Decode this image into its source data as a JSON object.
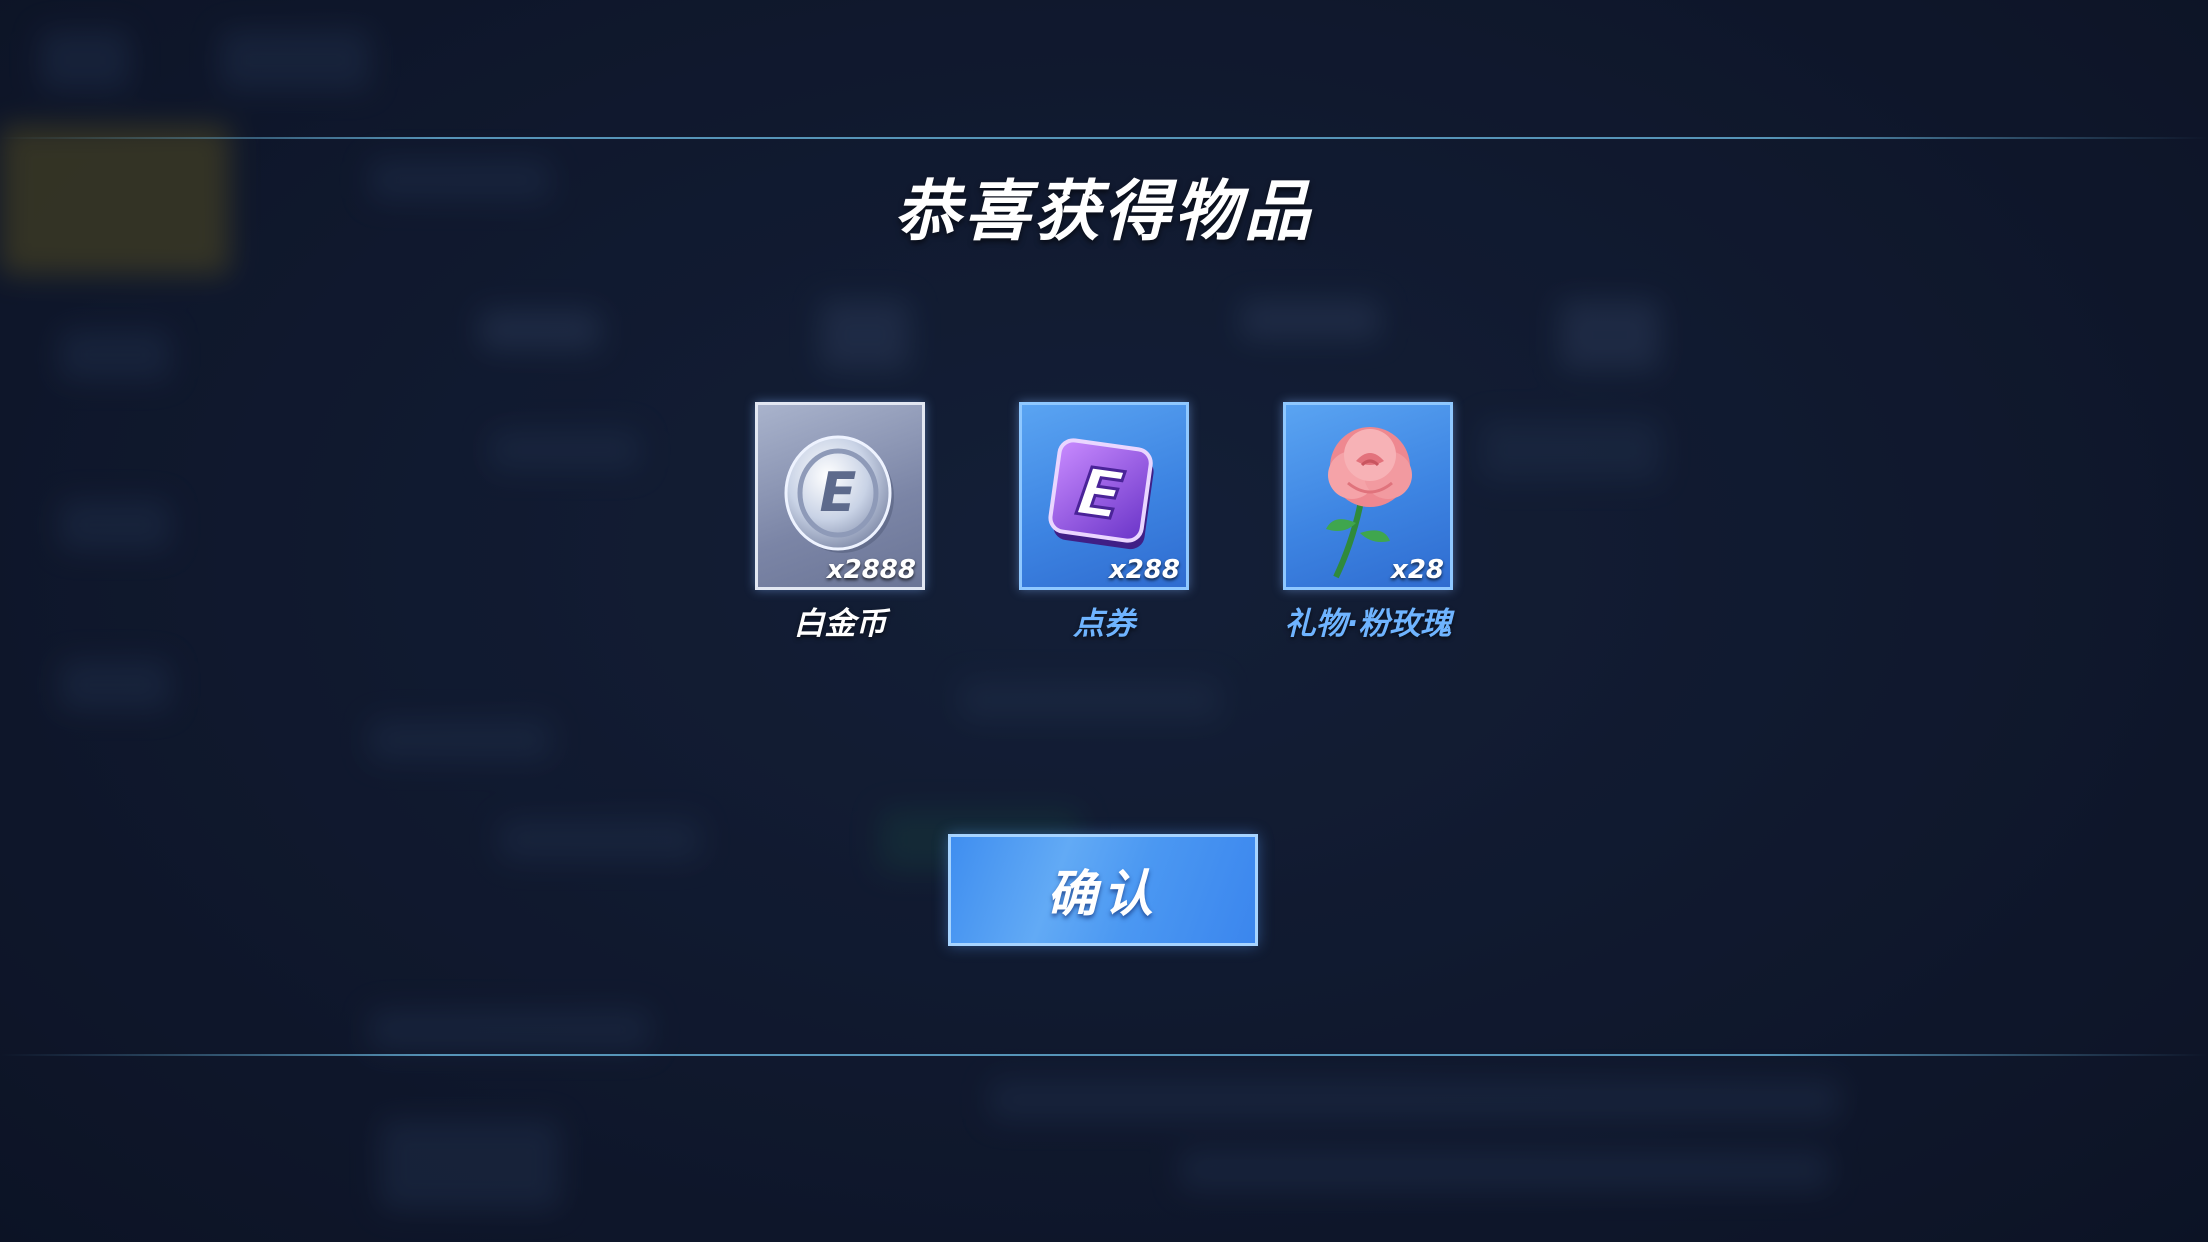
{
  "dialog": {
    "title": "恭喜获得物品",
    "confirm_label": "确认"
  },
  "items": [
    {
      "name": "白金币",
      "quantity": "x2888",
      "icon": "platinum-coin-icon",
      "name_color": "#ffffff"
    },
    {
      "name": "点券",
      "quantity": "x288",
      "icon": "voucher-icon",
      "name_color": "#6fb4ff"
    },
    {
      "name": "礼物·粉玫瑰",
      "quantity": "x28",
      "icon": "pink-rose-icon",
      "name_color": "#6fb4ff"
    }
  ],
  "colors": {
    "background": "#141d36",
    "accent_blue": "#4b98f2",
    "divider": "#6ebee6"
  }
}
